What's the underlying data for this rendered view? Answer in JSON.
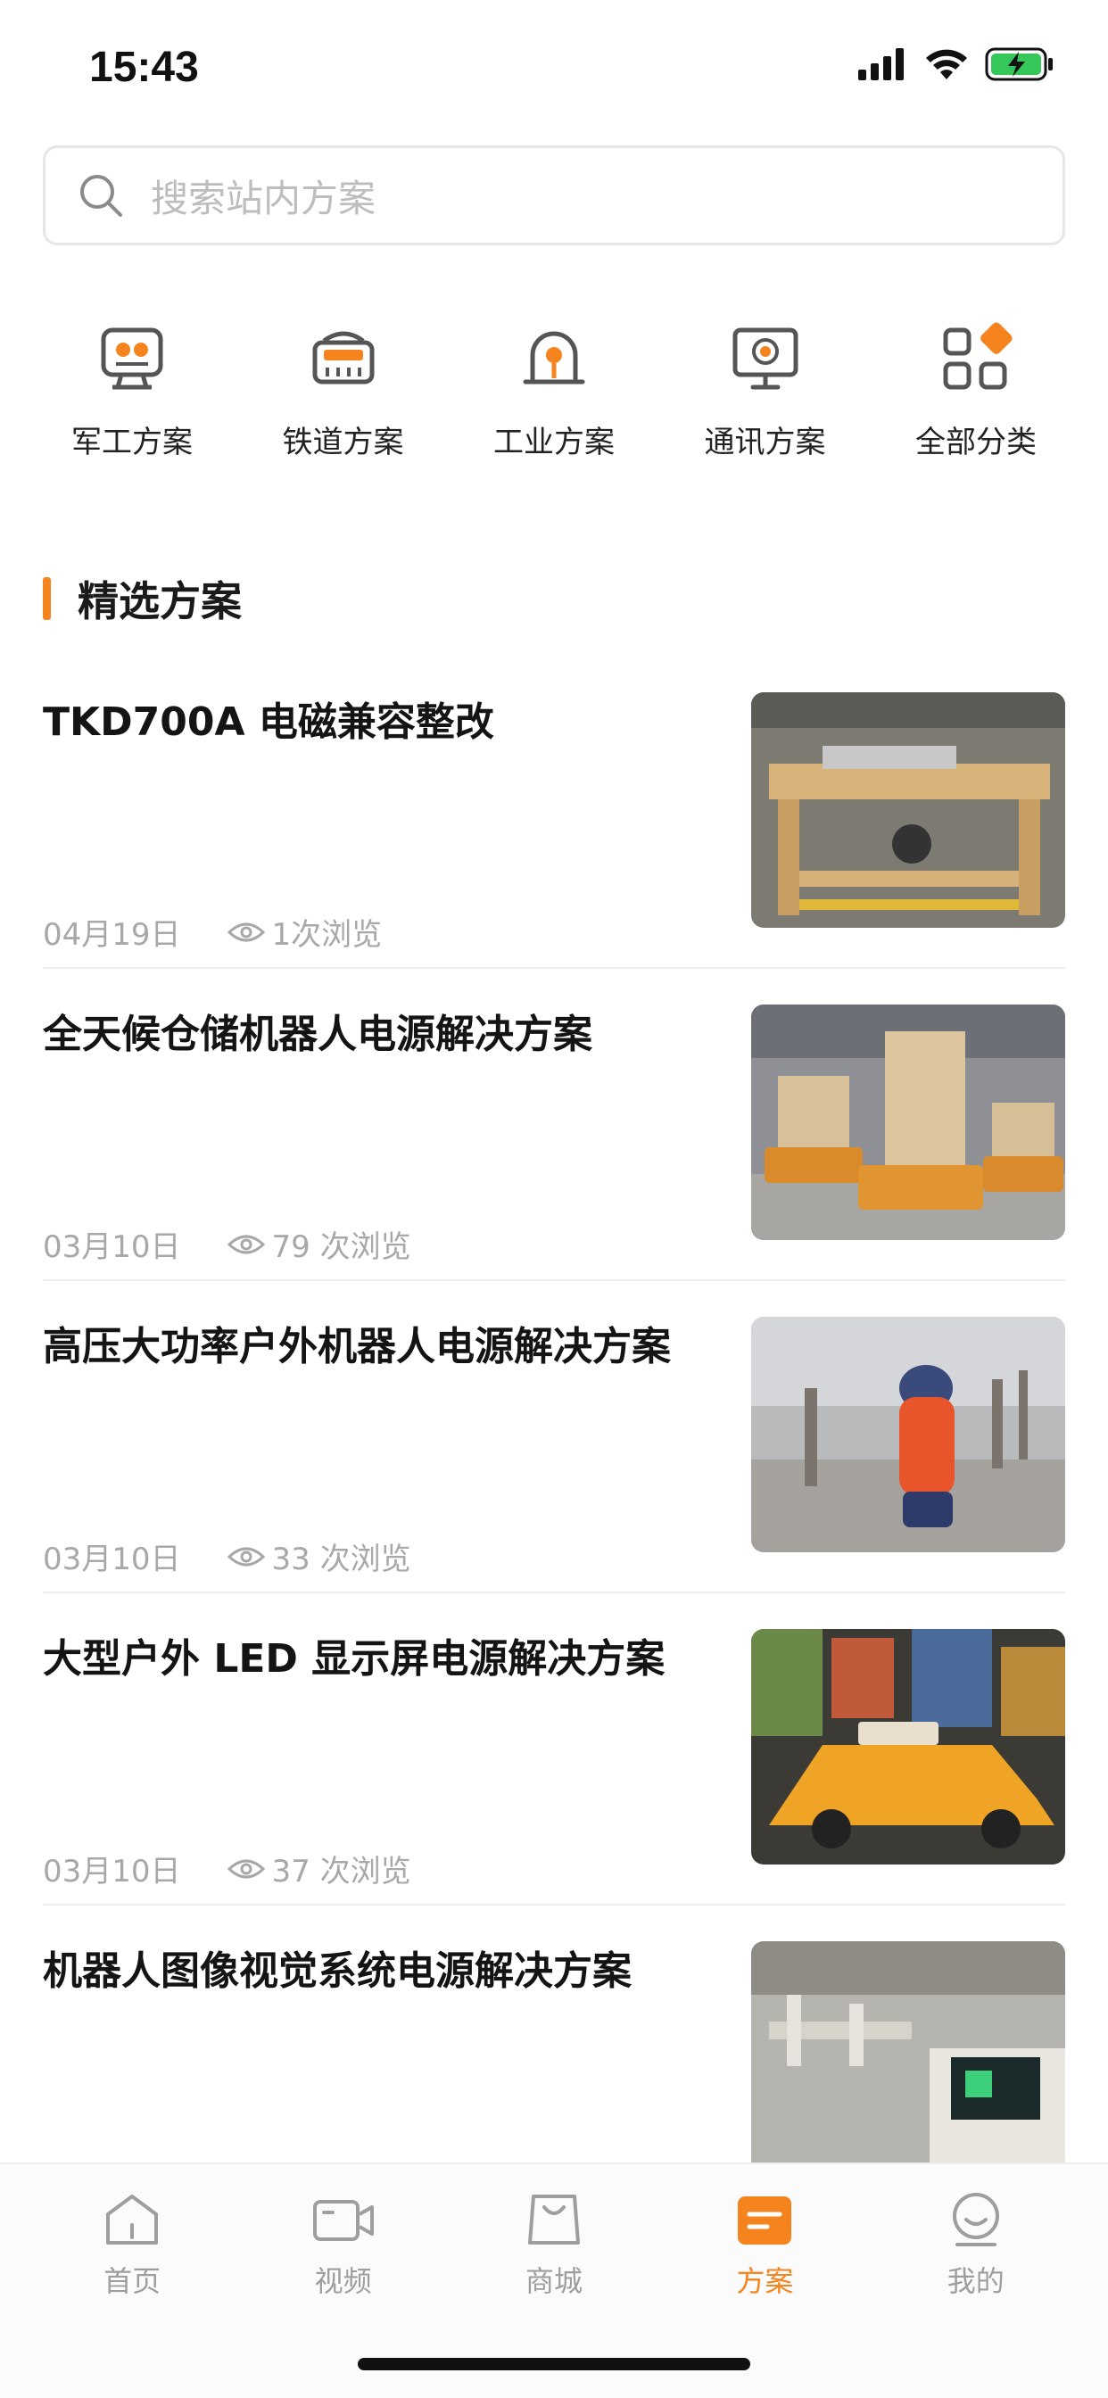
{
  "status": {
    "time": "15:43"
  },
  "search": {
    "placeholder": "搜索站内方案"
  },
  "categories": [
    {
      "label": "军工方案",
      "icon": "robot-face-icon"
    },
    {
      "label": "铁道方案",
      "icon": "train-icon"
    },
    {
      "label": "工业方案",
      "icon": "siren-icon"
    },
    {
      "label": "通讯方案",
      "icon": "monitor-icon"
    },
    {
      "label": "全部分类",
      "icon": "grid-icon"
    }
  ],
  "section": {
    "title": "精选方案"
  },
  "articles": [
    {
      "title": "TKD700A 电磁兼容整改",
      "date": "04月19日",
      "views": "1次浏览"
    },
    {
      "title": "全天候仓储机器人电源解决方案",
      "date": "03月10日",
      "views": "79 次浏览"
    },
    {
      "title": "高压大功率户外机器人电源解决方案",
      "date": "03月10日",
      "views": "33 次浏览"
    },
    {
      "title": "大型户外 LED 显示屏电源解决方案",
      "date": "03月10日",
      "views": "37 次浏览"
    },
    {
      "title": "机器人图像视觉系统电源解决方案",
      "date": "",
      "views": ""
    }
  ],
  "tabs": [
    {
      "label": "首页",
      "icon": "home-icon",
      "active": false
    },
    {
      "label": "视频",
      "icon": "video-icon",
      "active": false
    },
    {
      "label": "商城",
      "icon": "shopping-bag-icon",
      "active": false
    },
    {
      "label": "方案",
      "icon": "solution-icon",
      "active": true
    },
    {
      "label": "我的",
      "icon": "profile-icon",
      "active": false
    }
  ],
  "colors": {
    "accent": "#f5841f",
    "icon_gray": "#555555",
    "tab_gray": "#9e9e9e"
  }
}
